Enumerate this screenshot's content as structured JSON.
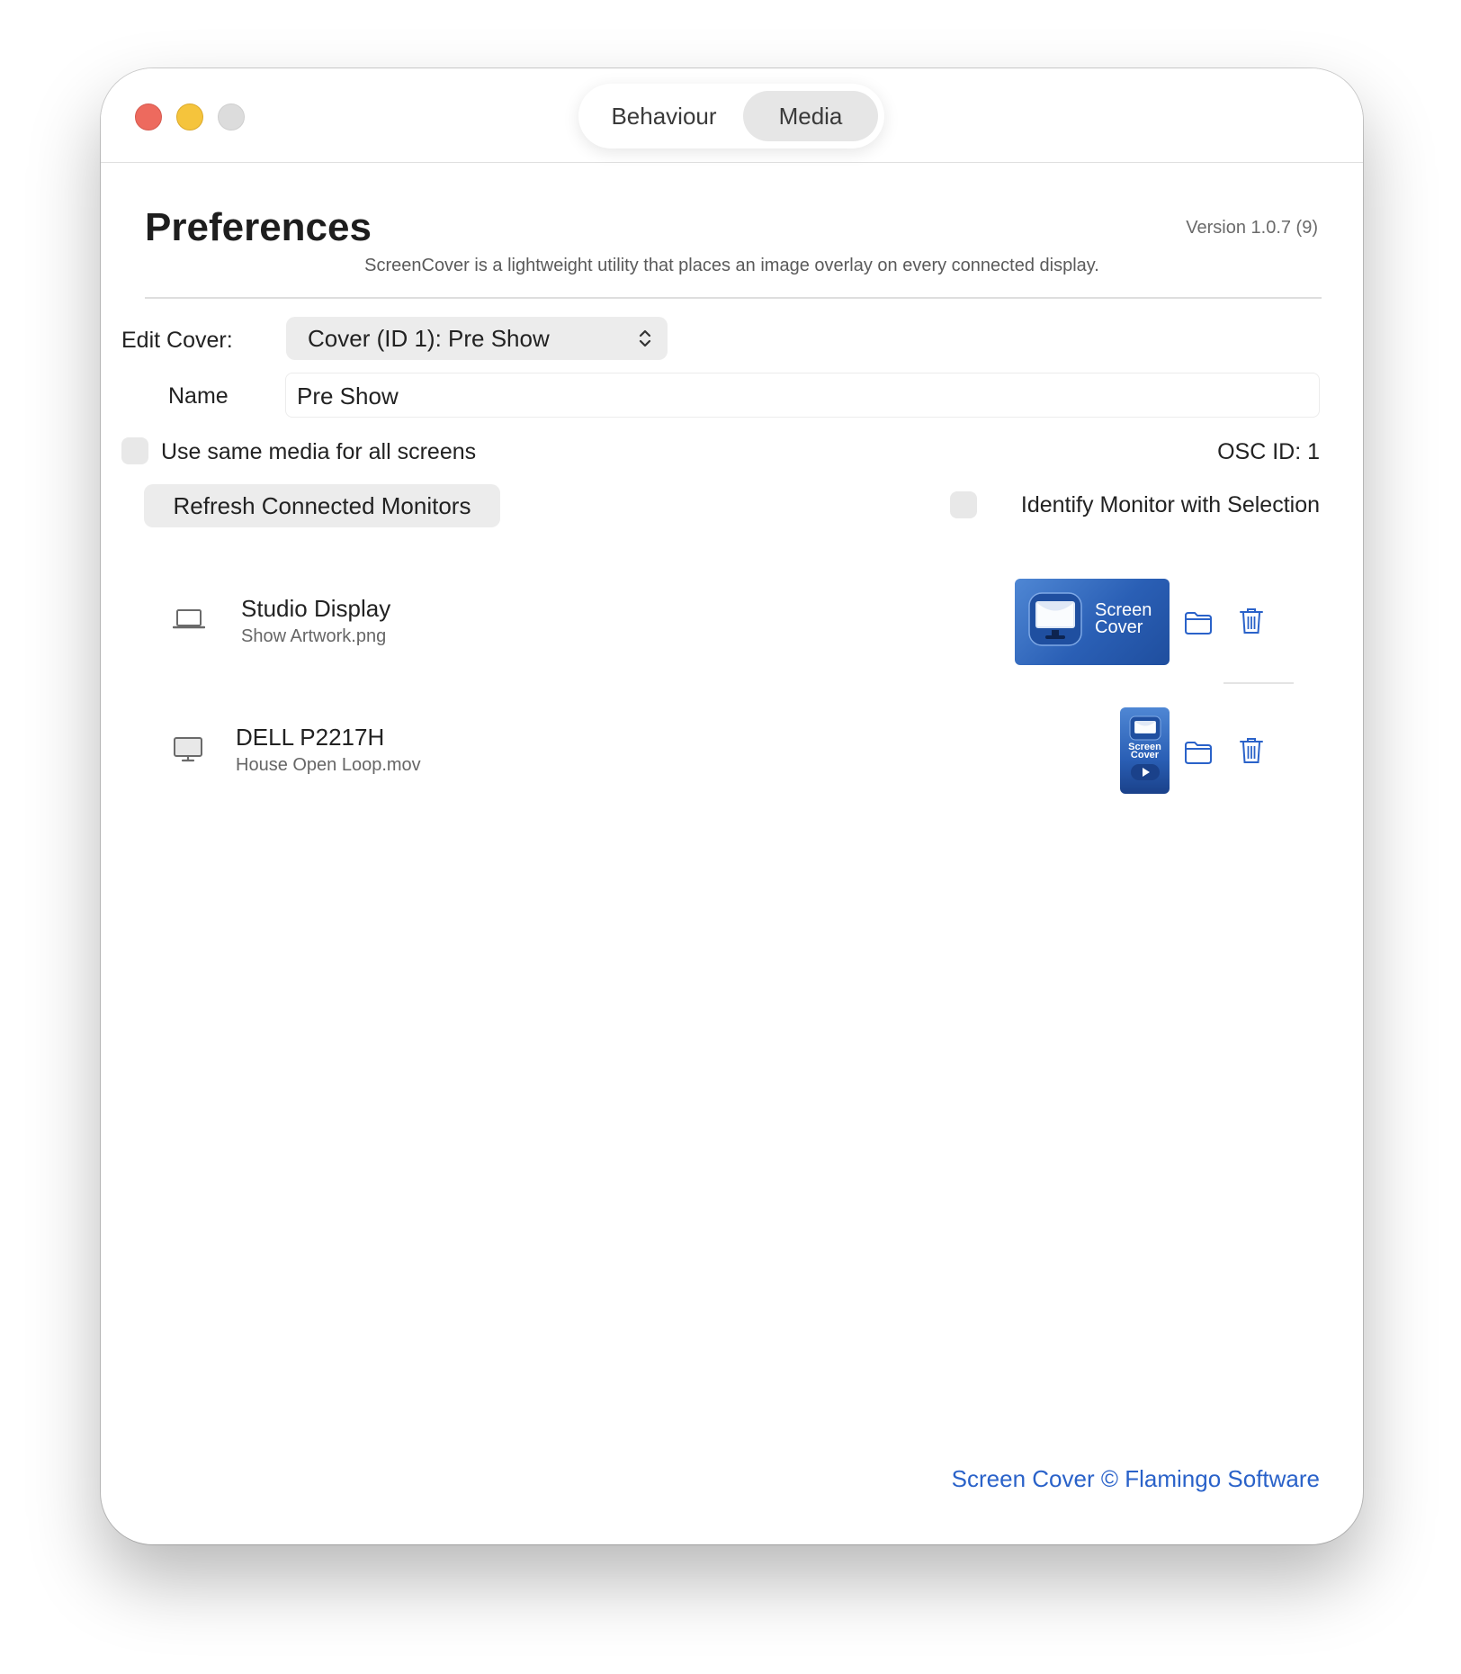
{
  "tabs": {
    "behaviour": "Behaviour",
    "media": "Media",
    "selected": "Media"
  },
  "header": {
    "title": "Preferences",
    "version": "Version 1.0.7 (9)",
    "subtitle": "ScreenCover is a lightweight utility that places an image overlay on every connected display."
  },
  "form": {
    "edit_cover_label": "Edit Cover:",
    "edit_cover_value": "Cover (ID 1): Pre Show",
    "name_label": "Name",
    "name_value": "Pre Show",
    "same_media_label": "Use same media for all screens",
    "same_media_checked": false,
    "osc_id": "OSC ID: 1",
    "refresh_button": "Refresh Connected Monitors",
    "identify_label": "Identify Monitor with Selection",
    "identify_checked": false
  },
  "monitors": [
    {
      "name": "Studio Display",
      "file": "Show Artwork.png",
      "icon": "laptop-icon",
      "thumb_text_line1": "Screen",
      "thumb_text_line2": "Cover"
    },
    {
      "name": "DELL P2217H",
      "file": "House Open Loop.mov",
      "icon": "desktop-monitor-icon",
      "thumb_text_line1": "Screen",
      "thumb_text_line2": "Cover"
    }
  ],
  "footer": {
    "link": "Screen Cover © Flamingo Software"
  },
  "colors": {
    "accent": "#2a62c9",
    "close": "#ed6a5e",
    "minimize": "#f5c43c",
    "zoom_disabled": "#dcdcdc",
    "thumb_blue": "#2a5fb5"
  }
}
